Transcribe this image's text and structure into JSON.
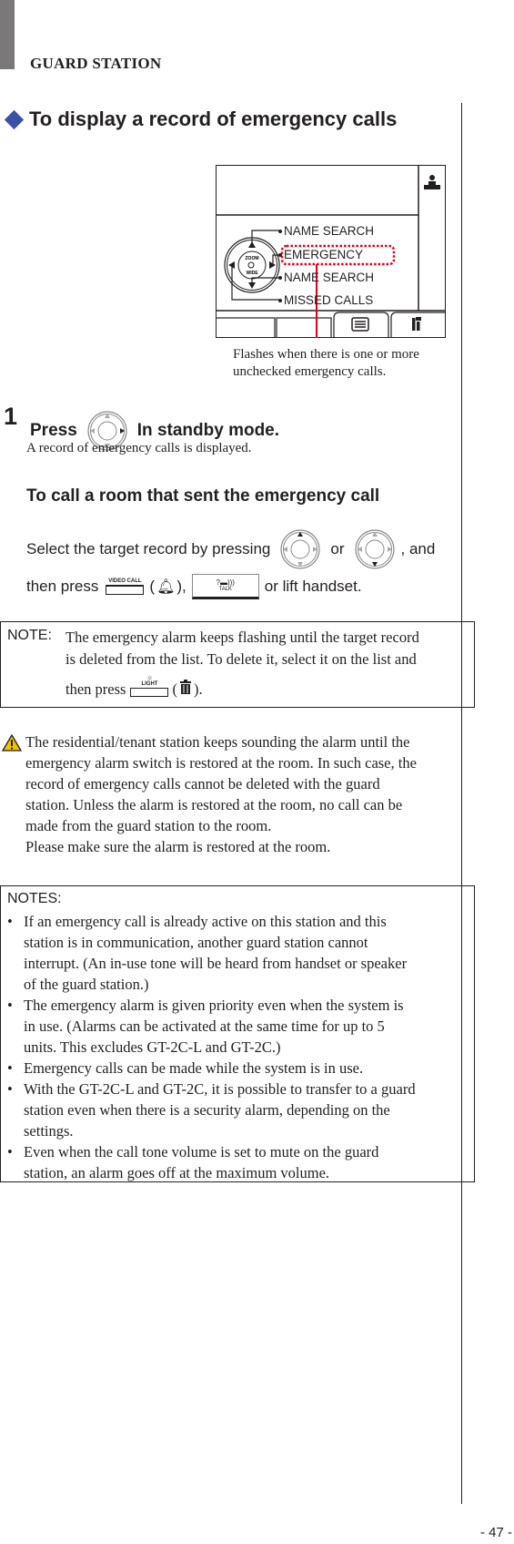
{
  "header": {
    "section_label": "GUARD STATION"
  },
  "heading": {
    "title": "To display a record of emergency calls",
    "bullet_color": "#3a4fa6"
  },
  "screen": {
    "menu_items": [
      "NAME SEARCH",
      "EMERGENCY",
      "NAME SEARCH",
      "MISSED CALLS"
    ],
    "highlighted_item": "EMERGENCY",
    "dial_labels": {
      "top": "ZOOM",
      "bottom": "WIDE"
    },
    "highlight_color": "#e3001b",
    "icons": [
      "guard-icon",
      "list-icon",
      "settings-tools-icon"
    ],
    "caption": "Flashes when there is one or more unchecked emergency calls."
  },
  "step1": {
    "number": "1",
    "press": "Press",
    "suffix": "In standby mode.",
    "result": "A record of emergency calls is displayed."
  },
  "call_room": {
    "heading": "To call a room that sent the emergency call",
    "line1_a": "Select the target record by pressing",
    "line1_or": "or",
    "line1_b": ", and",
    "line2_a": "then press",
    "video_call_label": "VIDEO CALL",
    "paren_open": "(",
    "paren_close": "),",
    "talk_label": "TALK",
    "line2_b": "or lift handset."
  },
  "note": {
    "label": "NOTE:",
    "line1": "The emergency alarm keeps flashing until the target record",
    "line2": "is deleted from the list. To delete it, select it on the list and",
    "line3_a": "then press",
    "light_label": "LIGHT",
    "paren_open": "(",
    "paren_close": ")."
  },
  "warning": {
    "lines": [
      "The residential/tenant station keeps sounding the alarm until the",
      "emergency alarm switch is restored at the room. In such case, the",
      "record of emergency calls cannot be deleted with the guard",
      "station. Unless the alarm is restored at the room, no call can be",
      "made from the guard station to the room.",
      "Please make sure the alarm is restored at the room."
    ],
    "icon_color": "#f2c200"
  },
  "notes": {
    "label": "NOTES:",
    "items": [
      [
        "If an emergency call is already active on this station and this",
        "station is in communication, another guard station cannot",
        "interrupt. (An in-use tone will be heard from handset or speaker",
        "of the guard station.)"
      ],
      [
        "The emergency alarm is given priority even when the system is",
        "in use. (Alarms can be activated at the same time for up to 5",
        "units. This excludes GT-2C-L and GT-2C.)"
      ],
      [
        "Emergency calls can be made while the system is in use."
      ],
      [
        "With the GT-2C-L and GT-2C, it is possible to transfer to a guard",
        "station even when there is a security alarm, depending on the",
        "settings."
      ],
      [
        "Even when the call tone volume is set to mute on the guard",
        "station, an alarm goes off at the maximum volume."
      ]
    ]
  },
  "footer": {
    "page_number": "- 47 -"
  }
}
